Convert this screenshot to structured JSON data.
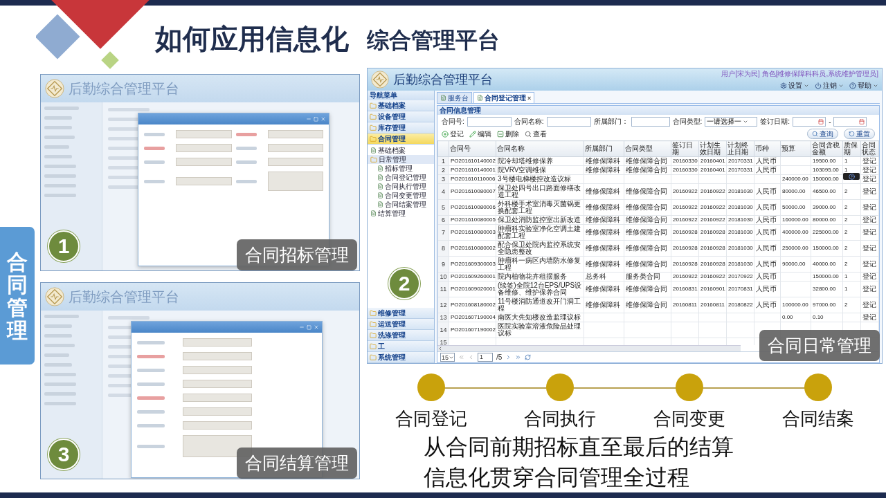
{
  "slide": {
    "title": "如何应用信息化",
    "subtitle": "综合管理平台",
    "side_tab": "合同管理"
  },
  "panels": [
    {
      "kind": "tender",
      "badge": "1",
      "caption": "合同招标管理",
      "app_title": "后勤综合管理平台"
    },
    {
      "kind": "settlement",
      "badge": "3",
      "caption": "合同结算管理",
      "app_title": "后勤综合管理平台"
    }
  ],
  "main_panel": {
    "badge": "2",
    "caption": "合同日常管理",
    "app_title": "后勤综合管理平台",
    "user_info": "用户[宋为民] 角色[维修保障科科员,系统维护管理员]",
    "top_menu": [
      {
        "label": "设置",
        "kind": "settings"
      },
      {
        "label": "注销",
        "kind": "logout"
      },
      {
        "label": "帮助",
        "kind": "help"
      }
    ],
    "nav_title": "导航菜单",
    "nav": [
      {
        "label": "基础档案",
        "expanded": false
      },
      {
        "label": "设备管理",
        "expanded": false
      },
      {
        "label": "库存管理",
        "expanded": false
      },
      {
        "label": "合同管理",
        "expanded": true,
        "children": [
          {
            "label": "基础档案",
            "expanded": false
          },
          {
            "label": "日常管理",
            "expanded": true,
            "children": [
              {
                "label": "招标管理"
              },
              {
                "label": "合同登记管理"
              },
              {
                "label": "合同执行管理"
              },
              {
                "label": "合同变更管理"
              },
              {
                "label": "合同结案管理"
              }
            ]
          },
          {
            "label": "结算管理",
            "expanded": false
          }
        ]
      },
      {
        "label": "维修管理",
        "expanded": false
      },
      {
        "label": "运送管理",
        "expanded": false
      },
      {
        "label": "洗涤管理",
        "expanded": false
      },
      {
        "label": "工",
        "expanded": false
      },
      {
        "label": "系统管理",
        "expanded": false
      }
    ],
    "tabs": [
      {
        "label": "服务台",
        "selected": false
      },
      {
        "label": "合同登记管理",
        "selected": true,
        "close_mark": "×"
      }
    ],
    "section_title": "合同信息管理",
    "filters": [
      {
        "label": "合同号:",
        "kind": "text"
      },
      {
        "label": "合同名称:",
        "kind": "text"
      },
      {
        "label": "所属部门：",
        "kind": "text"
      },
      {
        "label": "合同类型:",
        "kind": "select",
        "value": "一请选择一"
      },
      {
        "label": "签订日期:",
        "kind": "daterange",
        "separator": "-"
      }
    ],
    "actions": [
      {
        "label": "登记",
        "kind": "add"
      },
      {
        "label": "编辑",
        "kind": "edit"
      },
      {
        "label": "删除",
        "kind": "delete"
      },
      {
        "label": "查看",
        "kind": "view"
      }
    ],
    "search_buttons": [
      {
        "label": "查询",
        "kind": "search"
      },
      {
        "label": "重置",
        "kind": "reset"
      }
    ],
    "table": {
      "columns": [
        {
          "label": "合同号",
          "kind": "code"
        },
        {
          "label": "合同名称",
          "kind": "text"
        },
        {
          "label": "所属部门",
          "kind": "text"
        },
        {
          "label": "合同类型",
          "kind": "text"
        },
        {
          "label": "签订日期",
          "kind": "date"
        },
        {
          "label": "计划生效日期",
          "kind": "date"
        },
        {
          "label": "计划终止日期",
          "kind": "date"
        },
        {
          "label": "币种",
          "kind": "text"
        },
        {
          "label": "预算",
          "kind": "number"
        },
        {
          "label": "合同含税金额",
          "kind": "number"
        },
        {
          "label": "质保期",
          "kind": "number"
        },
        {
          "label": "合同状态",
          "kind": "text"
        }
      ],
      "rows": [
        {
          "no": "1",
          "cells": [
            "PO201610140002",
            "院冷却塔维修保养",
            "维修保障科",
            "维修保障合同",
            "20160330",
            "20160401",
            "20170331",
            "人民币",
            null,
            "19500.00",
            "1",
            "登记"
          ]
        },
        {
          "no": "2",
          "cells": [
            "PO201610140001",
            "院VRV空调维保",
            "维修保障科",
            "维修保障合同",
            "20160330",
            "20160401",
            "20170331",
            "人民币",
            null,
            "103095.00",
            "1",
            "登记"
          ]
        },
        {
          "no": "3",
          "cells": [
            "PO201610110006",
            "3号楼电梯楼控改造议标",
            null,
            null,
            null,
            null,
            null,
            null,
            "240000.00",
            "150000.00",
            null,
            "登记"
          ]
        },
        {
          "no": "4",
          "cells": [
            "PO201610080007",
            "保卫处四号出口路面修缮改造工程",
            "维修保障科",
            "维修保障合同",
            "20160922",
            "20160922",
            "20181030",
            "人民币",
            "80000.00",
            "46500.00",
            "2",
            "登记"
          ]
        },
        {
          "no": "5",
          "cells": [
            "PO201610080006",
            "外科楼手术室消毒灭菌锅更换配套工程",
            "维修保障科",
            "维修保障合同",
            "20160922",
            "20160922",
            "20181030",
            "人民币",
            "50000.00",
            "39000.00",
            "2",
            "登记"
          ]
        },
        {
          "no": "6",
          "cells": [
            "PO201610080005",
            "保卫处消防监控室出新改造",
            "维修保障科",
            "维修保障合同",
            "20160922",
            "20160922",
            "20181030",
            "人民币",
            "160000.00",
            "80000.00",
            "2",
            "登记"
          ]
        },
        {
          "no": "7",
          "cells": [
            "PO201610080003",
            "肿瘤科实验室净化空调土建配套工程",
            "维修保障科",
            "维修保障合同",
            "20160928",
            "20160928",
            "20181030",
            "人民币",
            "400000.00",
            "225000.00",
            "2",
            "登记"
          ]
        },
        {
          "no": "8",
          "cells": [
            "PO201610080002",
            "配合保卫处院内监控系统安全隐患整改",
            "维修保障科",
            "维修保障合同",
            "20160928",
            "20160928",
            "20181030",
            "人民币",
            "250000.00",
            "150000.00",
            "2",
            "登记"
          ]
        },
        {
          "no": "9",
          "cells": [
            "PO201609300003",
            "肿瘤科一病区内墙防水修复工程",
            "维修保障科",
            "维修保障合同",
            "20160928",
            "20160928",
            "20181030",
            "人民币",
            "90000.00",
            "40000.00",
            "2",
            "登记"
          ]
        },
        {
          "no": "10",
          "cells": [
            "PO201609260001",
            "院内植物花卉租摆服务",
            "总务科",
            "服务类合同",
            "20160922",
            "20160922",
            "20170922",
            "人民币",
            null,
            "150000.00",
            "1",
            "登记"
          ]
        },
        {
          "no": "11",
          "cells": [
            "PO201609020001",
            "(续签)全院12台EPS/UPS设备维修、维护保养合同",
            "维修保障科",
            "维修保障合同",
            "20160831",
            "20160901",
            "20170831",
            "人民币",
            null,
            "32800.00",
            "1",
            "登记"
          ]
        },
        {
          "no": "12",
          "cells": [
            "PO201608180002",
            "11号楼消防通道改开门洞工程",
            "维修保障科",
            "维修保障合同",
            "20160811",
            "20160811",
            "20180822",
            "人民币",
            "100000.00",
            "97000.00",
            "2",
            "登记"
          ]
        },
        {
          "no": "13",
          "cells": [
            "PO201607190004",
            "南医大先知楼改造监理议标",
            null,
            null,
            null,
            null,
            null,
            null,
            "0.00",
            "0.10",
            null,
            "登记"
          ]
        },
        {
          "no": "14",
          "cells": [
            "PO201607190002",
            "医院实验室溶液危险品处理议标"
          ]
        },
        {
          "no": "15",
          "cells": []
        }
      ]
    },
    "pager": {
      "page_size": "15",
      "page": "1",
      "total": "/5"
    }
  },
  "stages": [
    {
      "label": "合同登记"
    },
    {
      "label": "合同执行"
    },
    {
      "label": "合同变更"
    },
    {
      "label": "合同结案"
    }
  ],
  "summary": [
    "从合同前期招标直至最后的结算",
    "信息化贯穿合同管理全过程"
  ]
}
